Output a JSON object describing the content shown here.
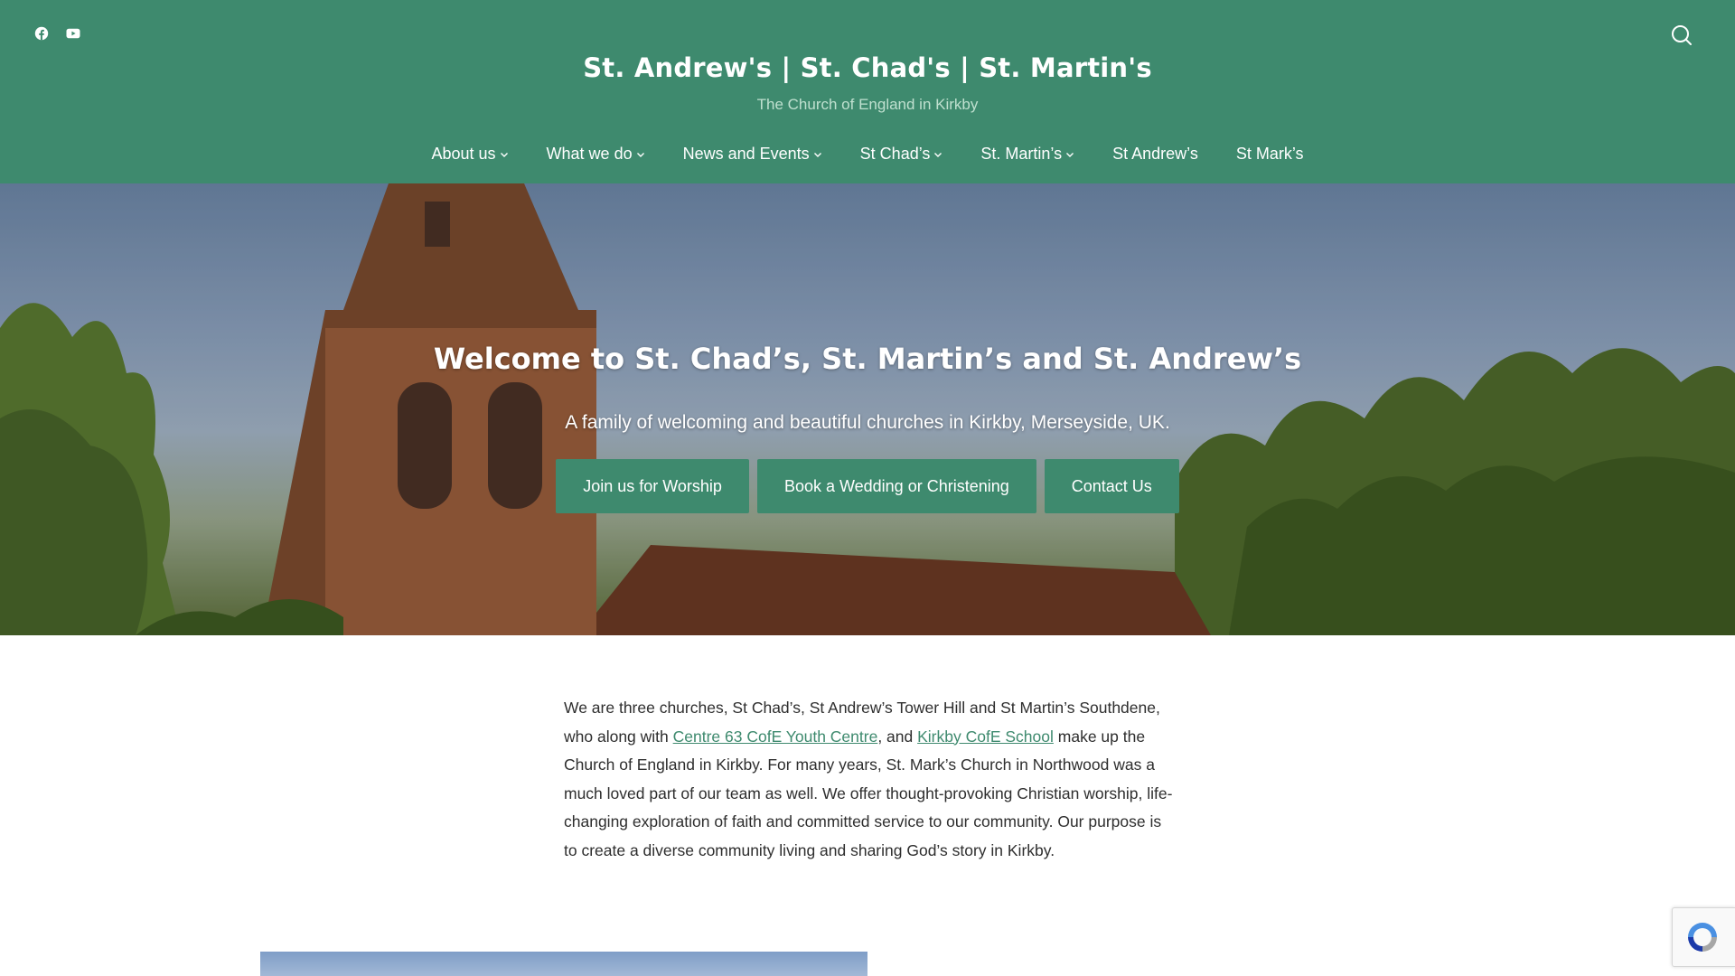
{
  "header": {
    "site_title": "St. Andrew's | St. Chad's | St. Martin's",
    "tagline": "The Church of England in Kirkby",
    "social_icons": [
      "facebook-icon",
      "youtube-icon"
    ],
    "search_icon": "search-icon",
    "background_color": "#3e8a6e"
  },
  "nav": {
    "items": [
      {
        "label": "About us",
        "has_dropdown": true
      },
      {
        "label": "What we do",
        "has_dropdown": true
      },
      {
        "label": "News and Events",
        "has_dropdown": true
      },
      {
        "label": "St Chad’s",
        "has_dropdown": true
      },
      {
        "label": "St. Martin’s",
        "has_dropdown": true
      },
      {
        "label": "St Andrew’s",
        "has_dropdown": false
      },
      {
        "label": "St Mark’s",
        "has_dropdown": false
      }
    ]
  },
  "hero": {
    "title": "Welcome to St. Chad’s, St. Martin’s and St. Andrew’s",
    "subtitle": "A family of welcoming and beautiful churches in Kirkby, Merseyside, UK.",
    "buttons": [
      {
        "label": "Join us for Worship"
      },
      {
        "label": "Book a Wedding or Christening"
      },
      {
        "label": "Contact Us"
      }
    ]
  },
  "intro": {
    "text_1": " We are three churches, St Chad’s, St Andrew’s Tower Hill and St Martin’s Southdene, who along with ",
    "link_1": "Centre 63 CofE Youth Centre",
    "text_2": ", and ",
    "link_2": "Kirkby CofE School",
    "text_3": " make up the Church of England in Kirkby. For many years, St. Mark’s Church in Northwood was a much loved part of our team as well. We offer thought-provoking Christian worship, life-changing exploration of faith and committed service to our community. Our purpose is to create a diverse community living and sharing God’s story in Kirkby."
  },
  "colors": {
    "accent": "#3e8a6e",
    "link": "#3e8a6e",
    "text": "#2e2e2e"
  }
}
